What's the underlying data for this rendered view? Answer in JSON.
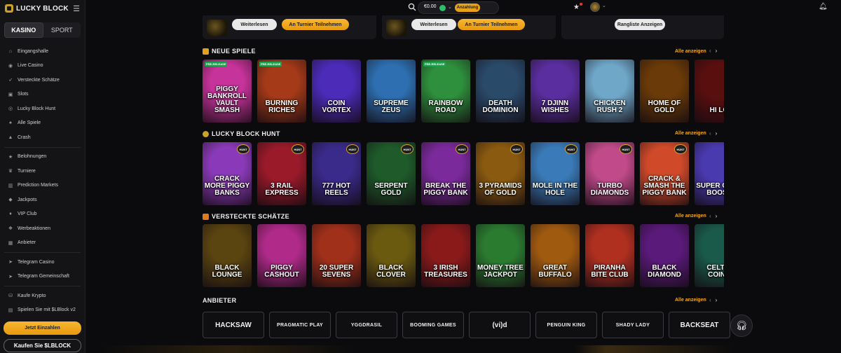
{
  "brand": {
    "name": "LUCKY BLOCK"
  },
  "sidebar": {
    "tabs": [
      {
        "label": "KASINO",
        "active": true
      },
      {
        "label": "SPORT",
        "active": false
      }
    ],
    "groups": [
      [
        {
          "label": "Eingangshalle",
          "icon": "lobby-icon"
        },
        {
          "label": "Live Casino",
          "icon": "live-icon"
        },
        {
          "label": "Versteckte Schätze",
          "icon": "rocket-icon"
        },
        {
          "label": "Slots",
          "icon": "slots-icon"
        },
        {
          "label": "Lucky Block Hunt",
          "icon": "hunt-icon"
        },
        {
          "label": "Alle Spiele",
          "icon": "cards-icon"
        },
        {
          "label": "Crash",
          "icon": "crash-icon"
        }
      ],
      [
        {
          "label": "Belohnungen",
          "icon": "star-icon"
        },
        {
          "label": "Turniere",
          "icon": "trophy-icon"
        },
        {
          "label": "Prediction Markets",
          "icon": "chart-icon"
        },
        {
          "label": "Jackpots",
          "icon": "jackpot-icon"
        },
        {
          "label": "VIP Club",
          "icon": "vip-icon"
        },
        {
          "label": "Werbeaktionen",
          "icon": "gift-icon"
        },
        {
          "label": "Anbieter",
          "icon": "provider-icon"
        }
      ],
      [
        {
          "label": "Telegram Casino",
          "icon": "telegram-icon"
        },
        {
          "label": "Telegram Gemeinschaft",
          "icon": "telegram-icon"
        }
      ],
      [
        {
          "label": "Kaufe Krypto",
          "icon": "crypto-icon"
        },
        {
          "label": "Spielen Sie mit $LBlock v2",
          "icon": "token-icon"
        }
      ]
    ],
    "deposit_label": "Jetzt Einzahlen",
    "buy_label": "Kaufen Sie $LBLOCK"
  },
  "topbar": {
    "balance": "€0.00",
    "deposit_label": "Anzahlung"
  },
  "promos": {
    "p1_more": "Weiterlesen",
    "p1_join": "An Turnier Teilnehmen",
    "p2_more": "Weiterlesen",
    "p2_join": "An Turnier Teilnehmen",
    "p3_ranking": "Rangliste Anzeigen"
  },
  "sections": {
    "new": {
      "title": "NEUE SPIELE",
      "see_all": "Alle anzeigen",
      "games": [
        {
          "name": "Piggy Bankroll Vault Smash",
          "tag": "PRE-RELEASE",
          "bg": "#c6339a"
        },
        {
          "name": "Burning Riches",
          "tag": "PRE-RELEASE",
          "bg": "#a43a18"
        },
        {
          "name": "Coin Vortex",
          "tag": "",
          "bg": "#4b2bb8"
        },
        {
          "name": "Supreme Zeus",
          "tag": "",
          "bg": "#2d6fb0"
        },
        {
          "name": "Rainbow Road",
          "tag": "PRE-RELEASE",
          "bg": "#2e8f3c"
        },
        {
          "name": "Death Dominion",
          "tag": "",
          "bg": "#2a4a6a"
        },
        {
          "name": "7 Djinn Wishes",
          "tag": "",
          "bg": "#5b2ea0"
        },
        {
          "name": "Chicken Rush 2",
          "tag": "",
          "bg": "#6fa7c9"
        },
        {
          "name": "Home of Gold",
          "tag": "",
          "bg": "#6a3a08"
        },
        {
          "name": "Hi Lo",
          "tag": "",
          "bg": "#5a0f0f"
        }
      ]
    },
    "hunt": {
      "title": "LUCKY BLOCK HUNT",
      "see_all": "Alle anzeigen",
      "hunt_badge": "HUNT",
      "games": [
        {
          "name": "Crack More Piggy Banks",
          "bg": "#8a3ab8"
        },
        {
          "name": "3 Rail Express",
          "bg": "#9a1a2a"
        },
        {
          "name": "777 Hot Reels",
          "bg": "#3a2a8a"
        },
        {
          "name": "Serpent Gold",
          "bg": "#1e5a2a"
        },
        {
          "name": "Break the Piggy Bank",
          "bg": "#7a2a9a"
        },
        {
          "name": "3 Pyramids of Gold",
          "bg": "#8a5a10"
        },
        {
          "name": "Mole in the Hole",
          "bg": "#3a7ab8"
        },
        {
          "name": "Turbo Diamonds",
          "bg": "#c04a8a"
        },
        {
          "name": "Crack & Smash the Piggy Bank",
          "bg": "#d04a2a"
        },
        {
          "name": "Super Cash Boost",
          "bg": "#4a3ab0"
        }
      ]
    },
    "hidden": {
      "title": "VERSTECKTE SCHÄTZE",
      "see_all": "Alle anzeigen",
      "games": [
        {
          "name": "Black Lounge",
          "bg": "#5a4410"
        },
        {
          "name": "Piggy Cashout",
          "bg": "#b02a8a"
        },
        {
          "name": "20 Super Sevens",
          "bg": "#a0301a"
        },
        {
          "name": "Black Clover",
          "bg": "#6a5a10"
        },
        {
          "name": "3 Irish Treasures",
          "bg": "#8a1a1a"
        },
        {
          "name": "Money Tree Jackpot",
          "bg": "#2a7a30"
        },
        {
          "name": "Great Buffalo",
          "bg": "#a05a10"
        },
        {
          "name": "Piranha Bite Club",
          "bg": "#b03020"
        },
        {
          "name": "Black Diamond",
          "bg": "#5a1a7a"
        },
        {
          "name": "Celtic Coins",
          "bg": "#1a5a4a"
        }
      ]
    },
    "providers": {
      "title": "ANBIETER",
      "see_all": "Alle anzeigen",
      "items": [
        "HACKSAW",
        "PRAGMATIC PLAY",
        "YGGDRASIL",
        "BOOMING GAMES",
        "(vi)d",
        "PENGUIN KING",
        "SHADY LADY",
        "BACKSEAT"
      ]
    }
  }
}
